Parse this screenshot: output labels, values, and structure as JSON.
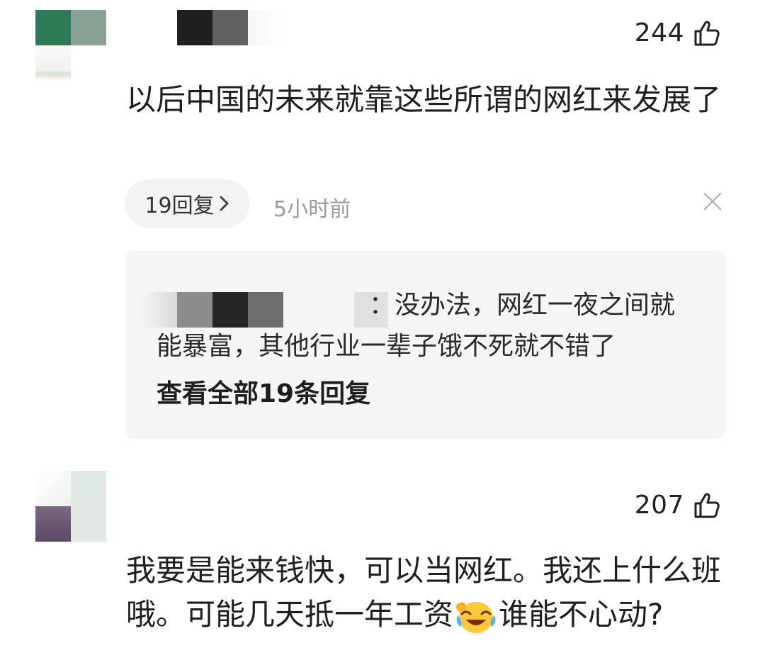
{
  "comments": [
    {
      "likes": "244",
      "text": "以后中国的未来就靠这些所谓的网红来发展了",
      "reply_count_label": "19回复",
      "time": "5小时前",
      "top_reply": {
        "text": "：没办法，网红一夜之间就能暴富，其他行业一辈子饿不死就不错了",
        "view_all_label": "查看全部19条回复"
      }
    },
    {
      "likes": "207",
      "text_part1": "我要是能来钱快，可以当网红。我还上什么班哦。可能几天抵一年工资",
      "text_part2": "谁能不心动?"
    }
  ],
  "icons": {
    "like": "thumbs-up-icon",
    "close": "close-icon",
    "chevron": "chevron-right-icon",
    "emoji": "laughing-crying-emoji"
  }
}
